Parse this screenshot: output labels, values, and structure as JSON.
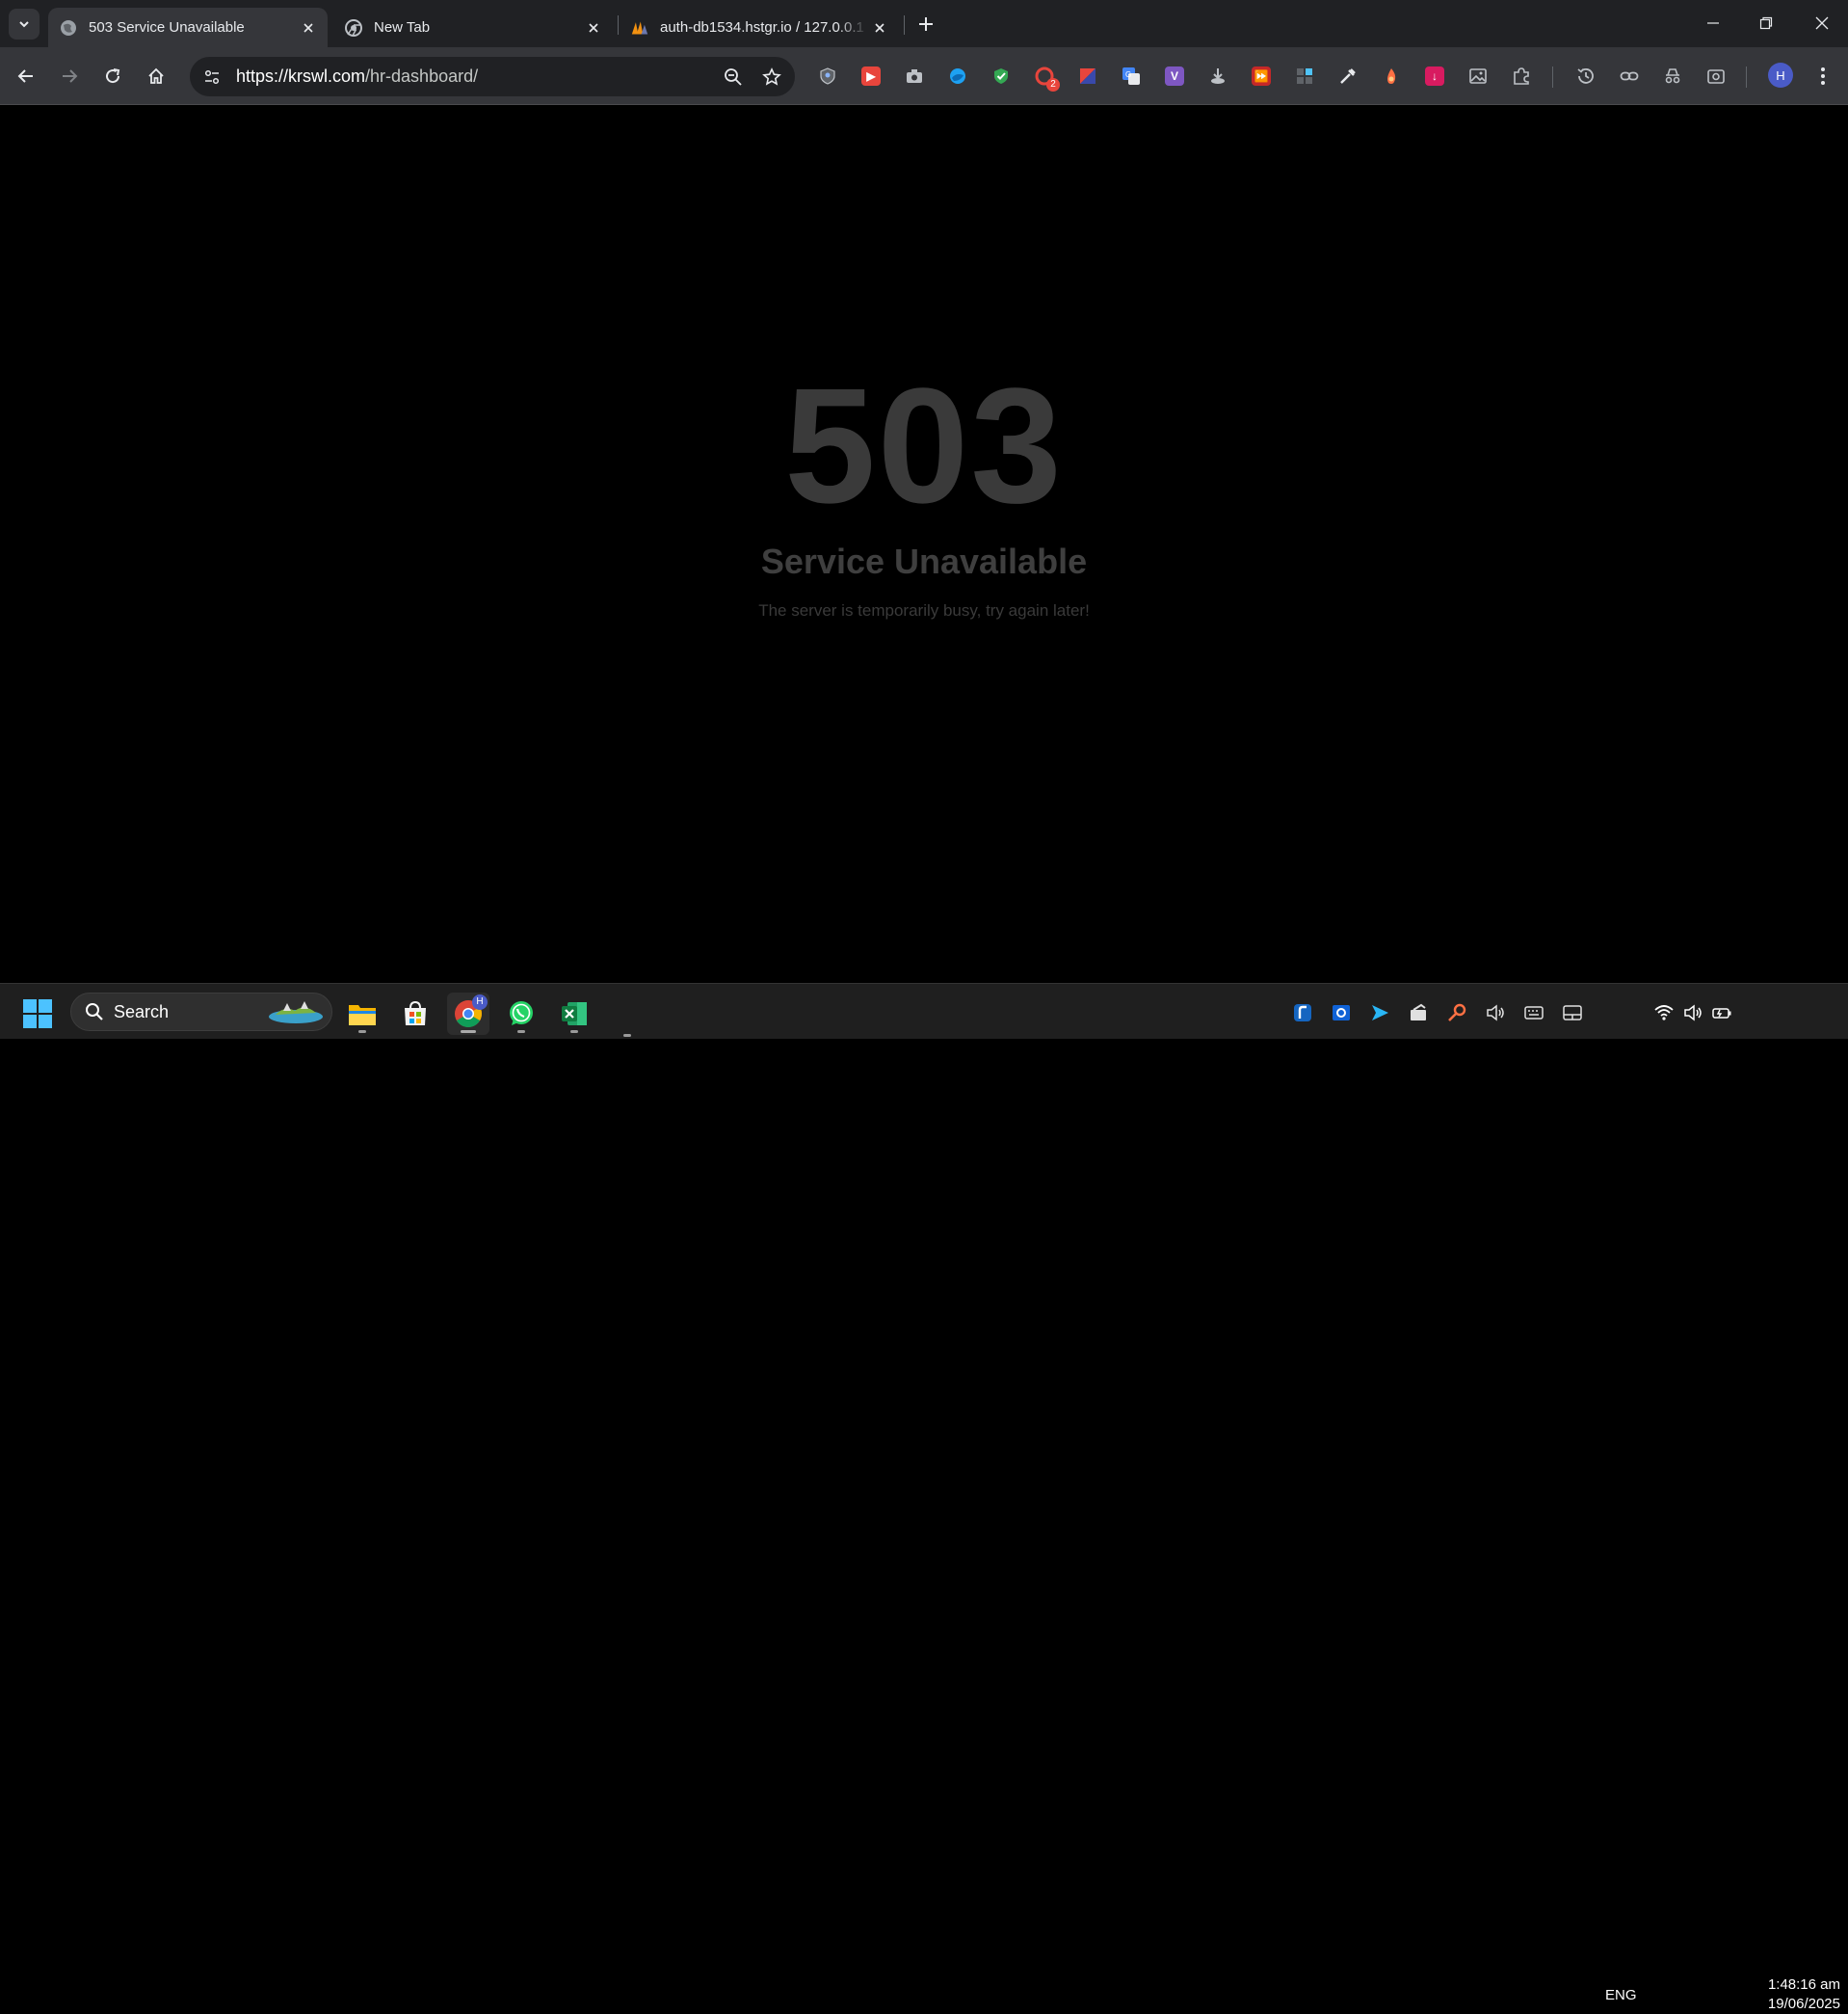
{
  "browser": {
    "tabs": [
      {
        "title": "503 Service Unavailable",
        "active": true,
        "favicon": "globe-icon"
      },
      {
        "title": "New Tab",
        "active": false,
        "favicon": "chrome-icon"
      },
      {
        "title": "auth-db1534.hstgr.io / 127.0.0.1",
        "active": false,
        "favicon": "phpmyadmin-icon"
      }
    ],
    "address_bar": {
      "host": "https://krswl.com",
      "path": "/hr-dashboard/"
    },
    "extensions": [
      {
        "name": "shield-extension-icon",
        "color": "#8ab4f8"
      },
      {
        "name": "youtube-extension-icon",
        "color": "#e8453c"
      },
      {
        "name": "camera-extension-icon",
        "color": "#bdc1c6"
      },
      {
        "name": "edge-extension-icon",
        "color": "#1da1f2"
      },
      {
        "name": "adguard-extension-icon",
        "color": "#34a853"
      },
      {
        "name": "grammar-extension-icon",
        "color": "#e8453c",
        "badge": "2"
      },
      {
        "name": "color-tag-extension-icon",
        "color": "#e8453c"
      },
      {
        "name": "translate-extension-icon",
        "color": "#4285f4"
      },
      {
        "name": "v-extension-icon",
        "color": "#7e57c2"
      },
      {
        "name": "download-extension-icon",
        "color": "#bdc1c6"
      },
      {
        "name": "speed-extension-icon",
        "color": "#c62828"
      },
      {
        "name": "apps-extension-icon",
        "color": "#4285f4"
      },
      {
        "name": "eyedropper-extension-icon",
        "color": "#e8eaed"
      },
      {
        "name": "flame-extension-icon",
        "color": "#ff7043"
      },
      {
        "name": "pink-download-extension-icon",
        "color": "#d81b60"
      },
      {
        "name": "image-extension-icon",
        "color": "#bdc1c6"
      },
      {
        "name": "puzzle-extension-icon",
        "color": "#bdc1c6"
      }
    ],
    "profile_initial": "H"
  },
  "page": {
    "code": "503",
    "title": "Service Unavailable",
    "description": "The server is temporarily busy, try again later!"
  },
  "taskbar": {
    "search_label": "Search",
    "apps": [
      "file-explorer-icon",
      "microsoft-store-icon",
      "chrome-icon",
      "whatsapp-icon",
      "excel-icon"
    ],
    "chrome_badge": "H",
    "language": "ENG",
    "time": "1:48:16 am",
    "date": "19/06/2025"
  }
}
